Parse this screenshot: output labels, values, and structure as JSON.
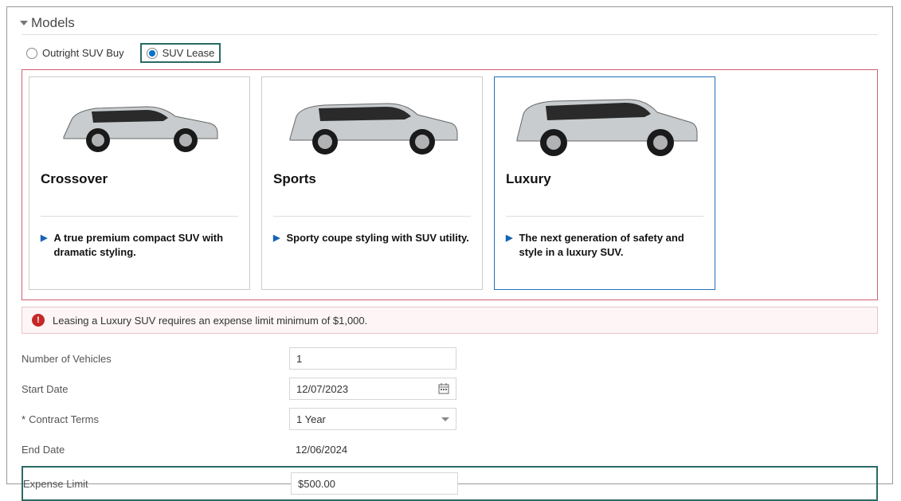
{
  "section_title": "Models",
  "radios": {
    "buy": "Outright SUV Buy",
    "lease": "SUV Lease"
  },
  "cards": [
    {
      "title": "Crossover",
      "desc": "A true premium compact SUV with dramatic styling."
    },
    {
      "title": "Sports",
      "desc": "Sporty coupe styling with SUV utility."
    },
    {
      "title": "Luxury",
      "desc": "The next generation of safety and style in a luxury SUV."
    }
  ],
  "alert": "Leasing a Luxury SUV requires an expense limit minimum of $1,000.",
  "form": {
    "num_vehicles_label": "Number of Vehicles",
    "num_vehicles_value": "1",
    "start_date_label": "Start Date",
    "start_date_value": "12/07/2023",
    "contract_terms_label": "Contract Terms",
    "contract_terms_value": "1 Year",
    "end_date_label": "End Date",
    "end_date_value": "12/06/2024",
    "expense_limit_label": "Expense Limit",
    "expense_limit_value": "$500.00"
  }
}
